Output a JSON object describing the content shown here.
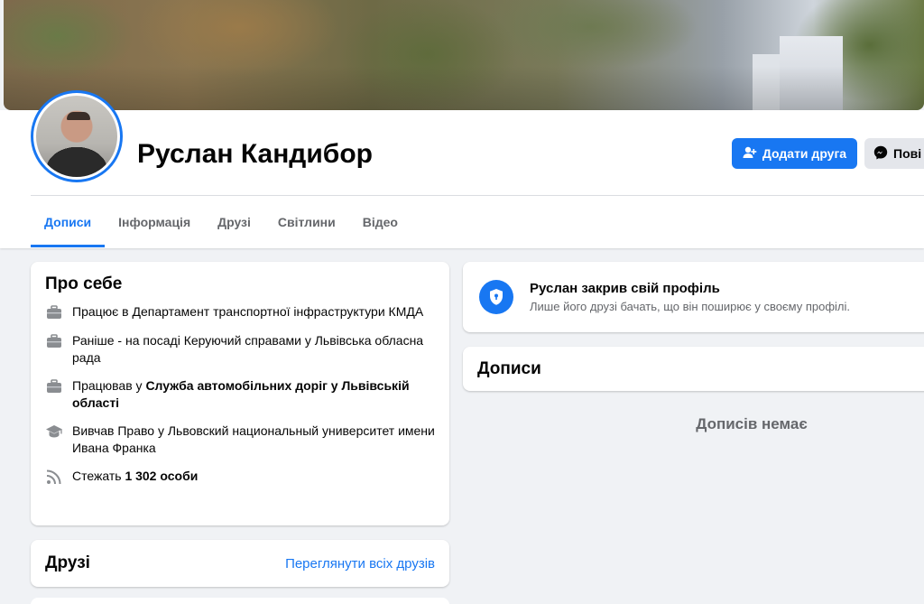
{
  "profile": {
    "name": "Руслан Кандибор"
  },
  "actions": {
    "add_friend": "Додати друга",
    "message": "Пові"
  },
  "tabs": [
    {
      "label": "Дописи",
      "active": true
    },
    {
      "label": "Інформація"
    },
    {
      "label": "Друзі"
    },
    {
      "label": "Світлини"
    },
    {
      "label": "Відео"
    }
  ],
  "about": {
    "title": "Про себе",
    "items": [
      {
        "icon": "briefcase-icon",
        "text": "Працює в Департамент транспортної інфраструктури КМДА"
      },
      {
        "icon": "briefcase-icon",
        "text": "Раніше - на посаді Керуючий справами у Львівська обласна рада"
      },
      {
        "icon": "briefcase-icon",
        "prefix": "Працював у ",
        "strong": "Служба автомобільних доріг у Львівській області"
      },
      {
        "icon": "graduation-cap-icon",
        "text": "Вивчав Право у Львовский национальный университет имени Ивана Франка"
      },
      {
        "icon": "rss-icon",
        "prefix": "Стежать ",
        "strong": "1 302 особи"
      }
    ]
  },
  "friends": {
    "title": "Друзі",
    "see_all": "Переглянути всіх друзів"
  },
  "locked": {
    "title": "Руслан закрив свій профіль",
    "subtitle": "Лише його друзі бачать, що він поширює у своєму профілі."
  },
  "posts": {
    "title": "Дописи",
    "empty": "Дописів немає"
  },
  "colors": {
    "accent": "#1877f2",
    "background": "#f0f2f5",
    "secondary_text": "#65676b"
  }
}
